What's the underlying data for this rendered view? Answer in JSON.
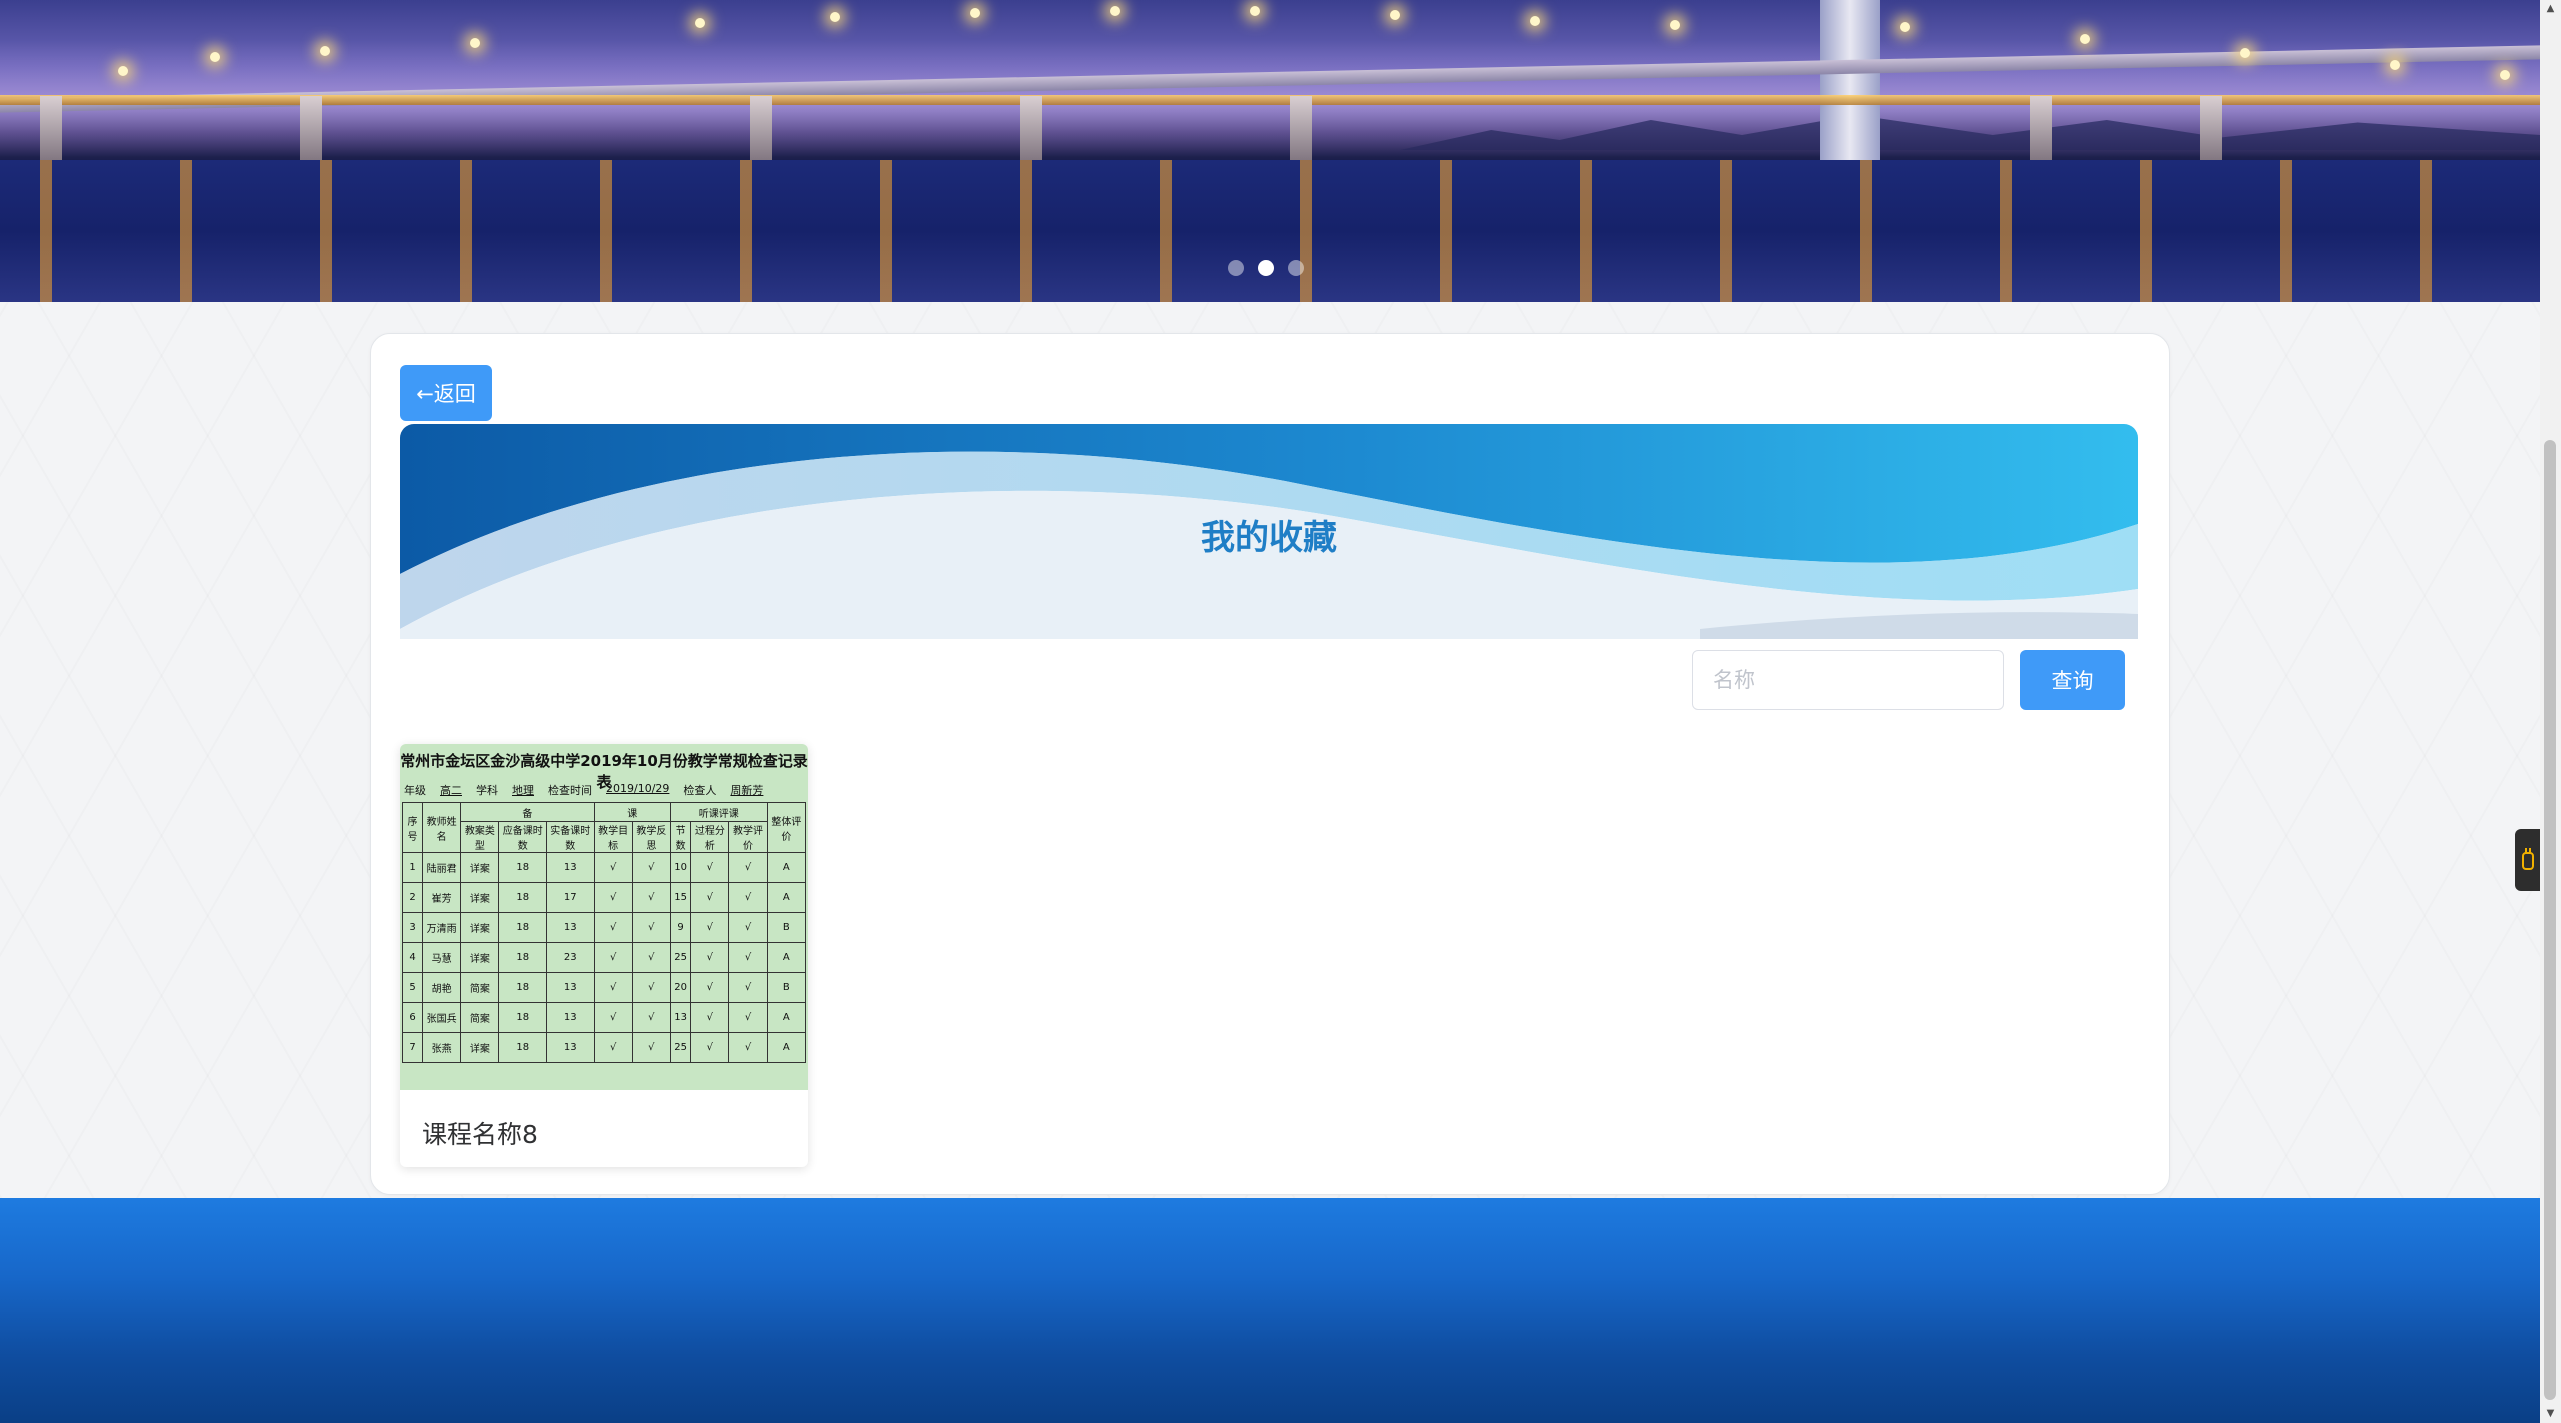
{
  "banner": {
    "slides": 3,
    "active_slide_index": 1
  },
  "card": {
    "back_label": "←返回",
    "hero_title": "我的收藏",
    "search": {
      "placeholder": "名称",
      "value": ""
    },
    "search_button": "查询",
    "items": [
      {
        "name": "课程名称8",
        "thumbnail": {
          "title": "常州市金坛区金沙高级中学2019年10月份教学常规检查记录表",
          "meta": [
            "年级",
            "高二",
            "学科",
            "地理",
            "检查时间",
            "2019/10/29",
            "检查人",
            "周新芳"
          ],
          "header_cells": [
            "序号",
            "教师姓名",
            "备",
            "课",
            "听课评课",
            "整体评价"
          ],
          "subheader_cells": [
            "教案类型",
            "应备课时数",
            "实备课时数",
            "教学目标",
            "教学反思",
            "节数",
            "过程分析",
            "教学评价"
          ],
          "rows": [
            [
              "1",
              "陆丽君",
              "详案",
              "18",
              "13",
              "√",
              "√",
              "10",
              "√",
              "√",
              "A"
            ],
            [
              "2",
              "崔芳",
              "详案",
              "18",
              "17",
              "√",
              "√",
              "15",
              "√",
              "√",
              "A"
            ],
            [
              "3",
              "万清雨",
              "详案",
              "18",
              "13",
              "√",
              "√",
              "9",
              "√",
              "√",
              "B"
            ],
            [
              "4",
              "马慧",
              "详案",
              "18",
              "23",
              "√",
              "√",
              "25",
              "√",
              "√",
              "A"
            ],
            [
              "5",
              "胡艳",
              "简案",
              "18",
              "13",
              "√",
              "√",
              "20",
              "√",
              "√",
              "B"
            ],
            [
              "6",
              "张国兵",
              "简案",
              "18",
              "13",
              "√",
              "√",
              "13",
              "√",
              "√",
              "A"
            ],
            [
              "7",
              "张燕",
              "详案",
              "18",
              "13",
              "√",
              "√",
              "25",
              "√",
              "√",
              "A"
            ]
          ]
        }
      }
    ]
  },
  "colors": {
    "primary": "#3f9af8",
    "hero_title": "#1f7ec6",
    "footer": "#1767c9",
    "thumbnail_bg": "#c8e6c4"
  },
  "icons": {
    "side_widget": "plug-icon",
    "scroll_up": "triangle-up-icon",
    "scroll_down": "triangle-down-icon"
  }
}
